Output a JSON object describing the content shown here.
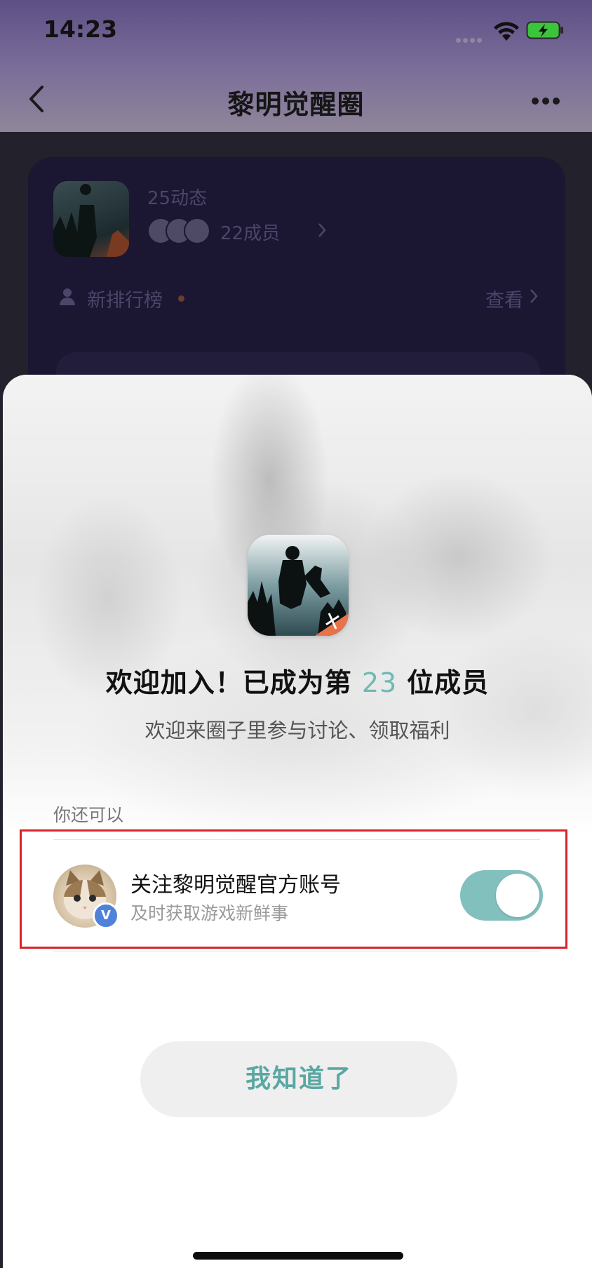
{
  "status_bar": {
    "time": "14:23"
  },
  "nav": {
    "title": "黎明觉醒圈"
  },
  "background_card": {
    "posts": "25动态",
    "members": "22成员",
    "ranking_label": "新排行榜",
    "view_label": "查看"
  },
  "dialog": {
    "welcome_prefix": "欢迎加入！已成为第",
    "member_number": "23",
    "welcome_suffix": "位成员",
    "subtitle": "欢迎来圈子里参与讨论、领取福利",
    "section_label": "你还可以",
    "follow": {
      "title": "关注黎明觉醒官方账号",
      "description": "及时获取游戏新鲜事",
      "toggle_on": true,
      "badge": "V"
    },
    "confirm_label": "我知道了"
  },
  "colors": {
    "accent": "#6dbab5",
    "toggle_on": "#82c0bd",
    "highlight_border": "#d8232a",
    "verified_badge": "#4f82d9"
  },
  "icons": [
    "wifi-icon",
    "battery-charging-icon",
    "back-chevron-icon",
    "more-icon",
    "user-icon",
    "chevron-right-icon"
  ]
}
